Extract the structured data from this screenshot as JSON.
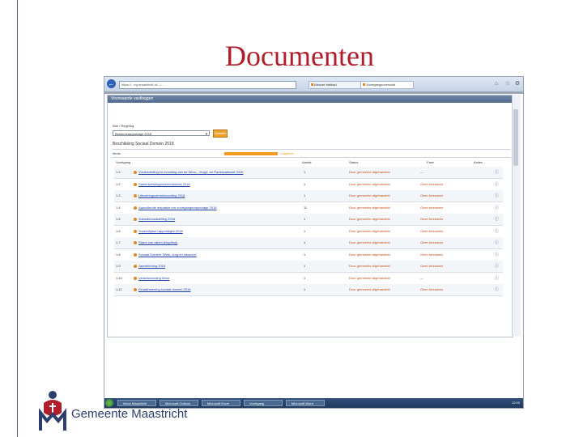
{
  "slide": {
    "title": "Documenten",
    "logo_text": "Gemeente Maastricht",
    "accent_color": "#b01e2c",
    "brand_color": "#2c3e6d"
  },
  "browser": {
    "address": "https://...eg.maastricht.nl/.../...",
    "search_label": "Bing",
    "tabs": [
      {
        "label": "Nieuwe tabblad",
        "icon": "tab-favicon"
      },
      {
        "label": "Voortgangsoverzicht",
        "icon": "tab-favicon"
      }
    ]
  },
  "app": {
    "header": "Voorwaarde vastleggen",
    "filter_label": "Wet / Regeling",
    "selected_option": "Bestuursrapportage 2018",
    "button_label": "Ophalen",
    "subtitle": "Beschikking Sociaal Domein 2018",
    "list_label": "Items",
    "progress_fraction": 1.0,
    "progress_label": "Volgende",
    "columns": [
      "Voortgang",
      "Aantal",
      "Status",
      "Fase",
      "Acties"
    ],
    "rows": [
      {
        "nr": "1.1",
        "title": "Voorbereiding en inrichting van de Wmo-, Jeugd- en Participatiewet 2019",
        "count": "1",
        "status": "Door gemeente afgehandeld",
        "status2": "—"
      },
      {
        "nr": "1.2",
        "title": "Samenwerkingsovereenkomst 2018",
        "count": "1",
        "status": "Door gemeente afgehandeld",
        "status2": "Geen bezwaren"
      },
      {
        "nr": "1.3",
        "title": "Uitvoeringsverantwoording 2018",
        "count": "1",
        "status": "Door gemeente afgehandeld",
        "status2": "Geen bezwaren"
      },
      {
        "nr": "1.4",
        "title": "Aanvullende afspraken en voortgangsrapportage 2018",
        "count": "11",
        "status": "Door gemeente afgehandeld",
        "status2": "Geen bezwaren"
      },
      {
        "nr": "1.5",
        "title": "Subsidievaststelling 2018",
        "count": "1",
        "status": "Door gemeente afgehandeld",
        "status2": "Geen bezwaren"
      },
      {
        "nr": "1.6",
        "title": "Tussentijdse rapportages 2018",
        "count": "1",
        "status": "Door gemeente afgehandeld",
        "status2": "Geen bezwaren"
      },
      {
        "nr": "1.7",
        "title": "Stand van zaken jeugdhulp",
        "count": "1",
        "status": "Door gemeente afgehandeld",
        "status2": "Geen bezwaren"
      },
      {
        "nr": "1.8",
        "title": "Sociaal Domein 'Werk, zorg en inkomen'",
        "count": "1",
        "status": "Door gemeente afgehandeld",
        "status2": "Geen bezwaren"
      },
      {
        "nr": "1.9",
        "title": "Jaarrekening 2018",
        "count": "1",
        "status": "Door gemeente afgehandeld",
        "status2": "Geen bezwaren"
      },
      {
        "nr": "1.10",
        "title": "Verantwoording Wmo",
        "count": "1",
        "status": "Door gemeente afgehandeld",
        "status2": "—"
      },
      {
        "nr": "1.11",
        "title": "Eindafrekening sociaal domein 2018",
        "count": "1",
        "status": "Door gemeente afgehandeld",
        "status2": "Geen bezwaren"
      }
    ]
  },
  "taskbar": {
    "items": [
      "Inbox Maastricht",
      "Microsoft Outlook",
      "Microsoft Excel",
      "Voortgang",
      "Microsoft Word"
    ],
    "clock": "12:00"
  }
}
